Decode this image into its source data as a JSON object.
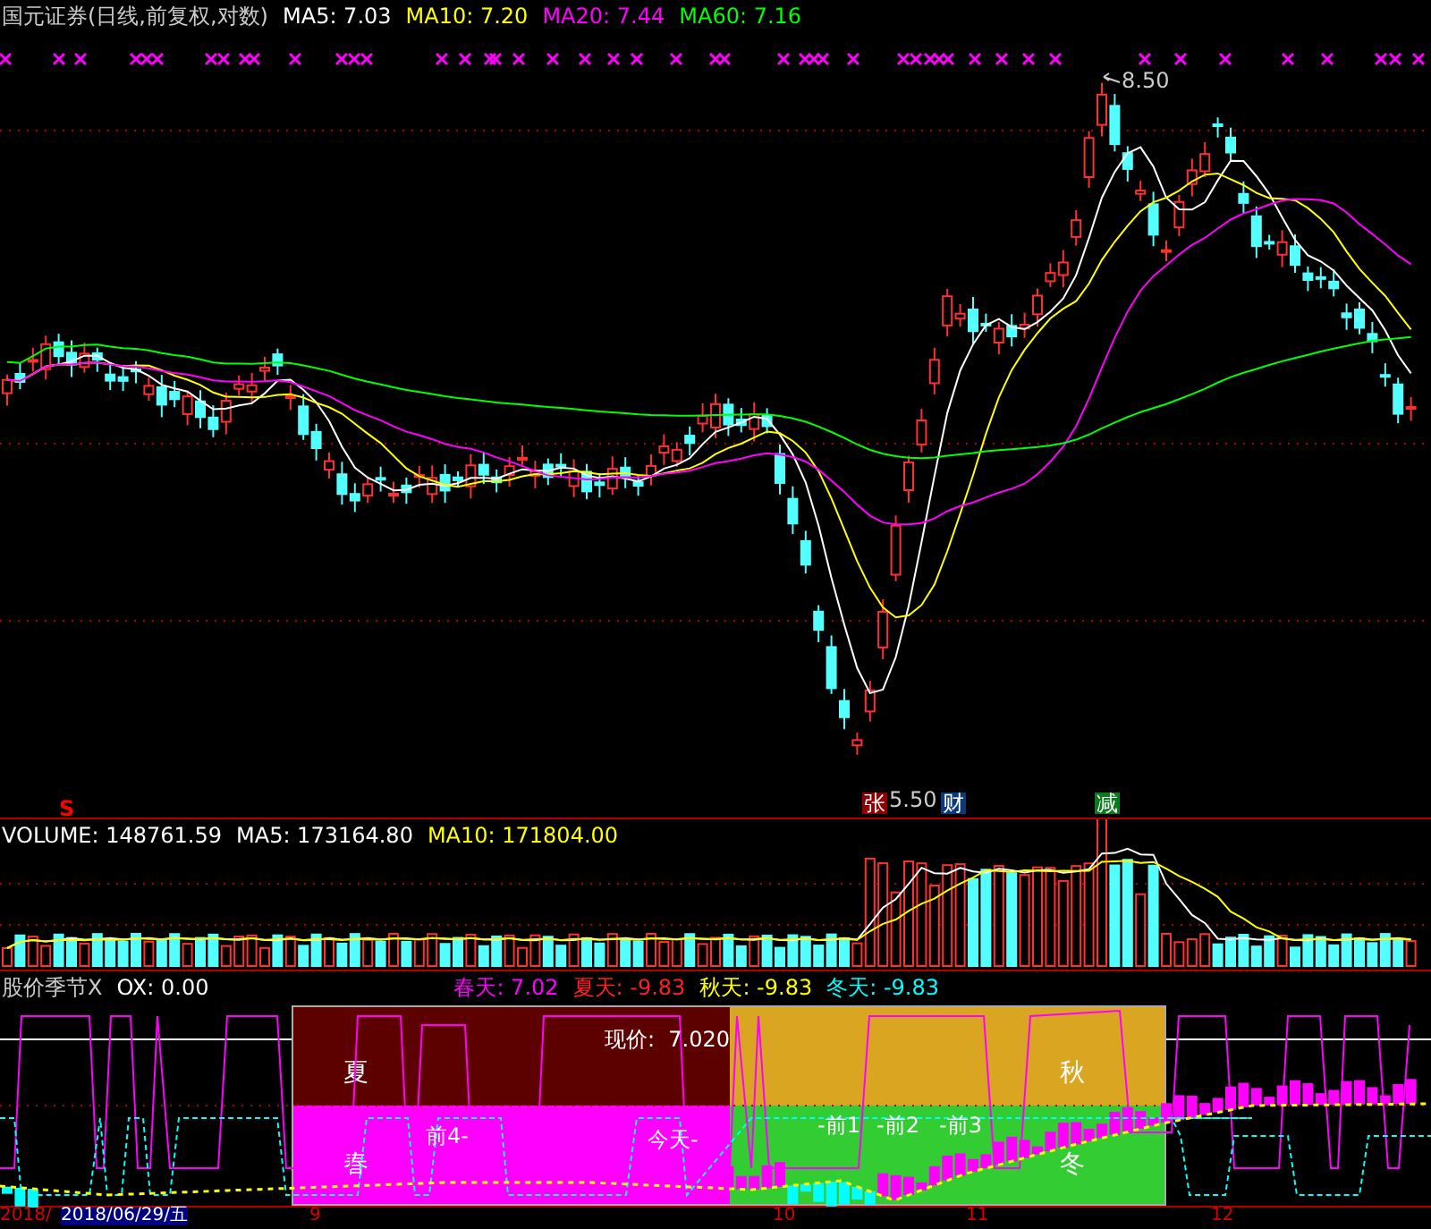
{
  "price_panel": {
    "title": "国元证券(日线,前复权,对数)",
    "indicators": [
      {
        "label": "MA5: 7.03",
        "color": "#ffffff"
      },
      {
        "label": "MA10: 7.20",
        "color": "#ffff00"
      },
      {
        "label": "MA20: 7.44",
        "color": "#ff00ff"
      },
      {
        "label": "MA60: 7.16",
        "color": "#00ff00"
      }
    ],
    "high_label": "8.50",
    "low_label": "5.50",
    "signals": [
      {
        "text": "S",
        "kind": "dollar",
        "color": "#ff0000"
      },
      {
        "text": "张",
        "kind": "badge",
        "color": "#8b0000"
      },
      {
        "text": "财",
        "kind": "badge",
        "color": "#0a3a7a"
      },
      {
        "text": "减",
        "kind": "badge",
        "color": "#0a7a1a"
      }
    ]
  },
  "volume_panel": {
    "indicators": [
      {
        "label": "VOLUME: 148761.59",
        "color": "#ffffff"
      },
      {
        "label": "MA5: 173164.80",
        "color": "#ffffff"
      },
      {
        "label": "MA10: 171804.00",
        "color": "#ffff00"
      }
    ]
  },
  "season_panel": {
    "title": "股价季节X",
    "indicators": [
      {
        "label": "OX: 0.00",
        "color": "#ffffff"
      },
      {
        "label": "春天: 7.02",
        "color": "#ff00ff"
      },
      {
        "label": "夏天: -9.83",
        "color": "#ff2020"
      },
      {
        "label": "秋天: -9.83",
        "color": "#ffff00"
      },
      {
        "label": "冬天: -9.83",
        "color": "#00ffff"
      }
    ],
    "quadrants": [
      {
        "label": "夏",
        "color": "#5c0000"
      },
      {
        "label": "秋",
        "color": "#daa520"
      },
      {
        "label": "春",
        "color": "#ff00ff"
      },
      {
        "label": "冬",
        "color": "#33cc33"
      }
    ],
    "price_label": "现价:  7.020",
    "day_labels": [
      "前4-",
      "今天-",
      "-前1",
      "-前2",
      "-前3"
    ]
  },
  "axis": {
    "start_label": "2018/",
    "cursor_date": "2018/06/29/五",
    "month_labels": [
      "9",
      "10",
      "11",
      "12"
    ]
  }
}
